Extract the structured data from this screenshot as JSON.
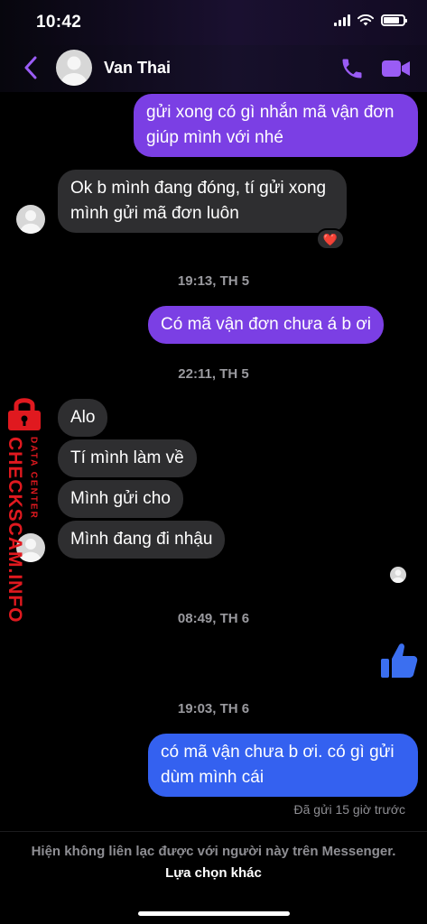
{
  "status_bar": {
    "time": "10:42"
  },
  "header": {
    "contact_name": "Van Thai"
  },
  "messages": [
    {
      "text": "gửi xong có gì nhắn mã vận đơn giúp mình với nhé"
    },
    {
      "text": "Ok b mình đang đóng, tí gửi xong mình gửi mã đơn luôn",
      "reaction": "❤️"
    },
    {
      "text": "Có mã vận đơn chưa á b ơi"
    },
    {
      "text": "Alo"
    },
    {
      "text": "Tí mình làm về"
    },
    {
      "text": "Mình gửi cho"
    },
    {
      "text": "Mình đang đi nhậu"
    },
    {
      "text": "có mã vận chưa b ơi. có gì gửi dùm mình cái"
    }
  ],
  "timestamps": [
    "19:13, TH 5",
    "22:11, TH 5",
    "08:49, TH 6",
    "19:03, TH 6"
  ],
  "sent_status": "Đã gửi 15 giờ trước",
  "watermark": {
    "brand": "CHECKSCAM.INFO",
    "sub": "DATA CENTER"
  },
  "footer": {
    "notice": "Hiện không liên lạc được với người này trên Messenger.",
    "link": "Lựa chọn khác"
  },
  "colors": {
    "accent": "#9a5cf5",
    "outgoing_bubble": "#7b3fe4",
    "outgoing_bubble_latest": "#3461f0",
    "incoming_bubble": "#2e2e30",
    "watermark": "#e0191f"
  },
  "icons": {
    "back": "chevron-left-icon",
    "call": "phone-icon",
    "video": "video-camera-icon",
    "like": "thumbs-up-icon"
  }
}
